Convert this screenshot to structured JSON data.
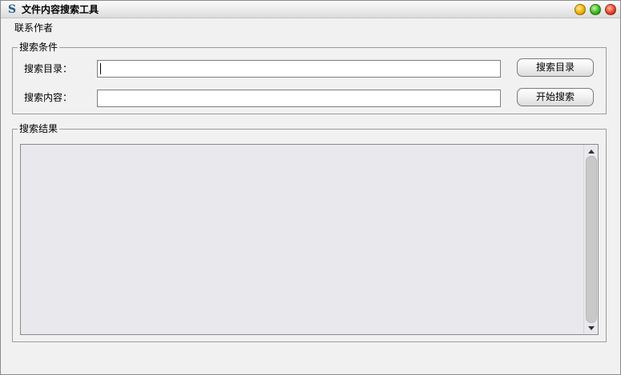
{
  "window": {
    "title": "文件内容搜索工具",
    "icon": "s-app-icon",
    "controls": [
      "minimize-icon",
      "maximize-icon",
      "close-icon"
    ]
  },
  "menu": {
    "items": [
      {
        "label": "联系作者"
      }
    ]
  },
  "search_conditions": {
    "legend": "搜索条件",
    "directory": {
      "label": "搜索目录：",
      "value": "",
      "button_label": "搜索目录"
    },
    "content": {
      "label": "搜索内容：",
      "value": "",
      "button_label": "开始搜索"
    }
  },
  "results": {
    "legend": "搜索结果",
    "text": ""
  }
}
